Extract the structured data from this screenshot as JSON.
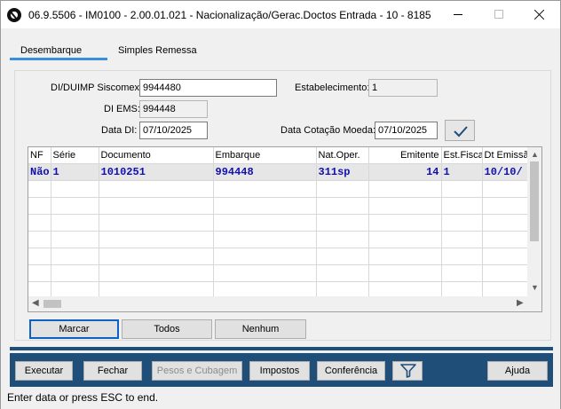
{
  "window": {
    "title": "06.9.5506 - IM0100 - 2.00.01.021 - Nacionalização/Gerac.Doctos Entrada - 10 - 8185"
  },
  "tabs": [
    {
      "label": "Desembarque",
      "active": true
    },
    {
      "label": "Simples Remessa",
      "active": false
    }
  ],
  "form": {
    "di_duimp_label": "DI/DUIMP Siscomex:",
    "di_duimp_value": "9944480",
    "estabelecimento_label": "Estabelecimento:",
    "estabelecimento_value": "1",
    "di_ems_label": "DI EMS:",
    "di_ems_value": "994448",
    "data_di_label": "Data DI:",
    "data_di_value": "07/10/2025",
    "data_cotacao_label": "Data Cotação Moeda:",
    "data_cotacao_value": "07/10/2025",
    "confirm_icon": "check-icon"
  },
  "grid": {
    "columns": [
      "NF",
      "Série",
      "Documento",
      "Embarque",
      "Nat.Oper.",
      "Emitente",
      "Est.Fisca",
      "Dt Emissão"
    ],
    "rows": [
      [
        "Não",
        "1",
        "1010251",
        "994448",
        "311sp",
        "14",
        "1",
        "10/10/"
      ]
    ],
    "selected_row": 0,
    "text_color": "#1010b0"
  },
  "selection_buttons": {
    "marcar": "Marcar",
    "todos": "Todos",
    "nenhum": "Nenhum"
  },
  "toolbar": {
    "executar": "Executar",
    "fechar": "Fechar",
    "pesos": "Pesos e Cubagem",
    "impostos": "Impostos",
    "conferencia": "Conferência",
    "filter_icon": "filter-icon",
    "ajuda": "Ajuda",
    "background": "#1f4e78"
  },
  "status": {
    "text": "Enter data or press ESC to end."
  },
  "colors": {
    "accent": "#3a8fdc",
    "toolbar": "#1f4e78",
    "grid_text": "#1010b0",
    "focus_border": "#0b62c4"
  }
}
